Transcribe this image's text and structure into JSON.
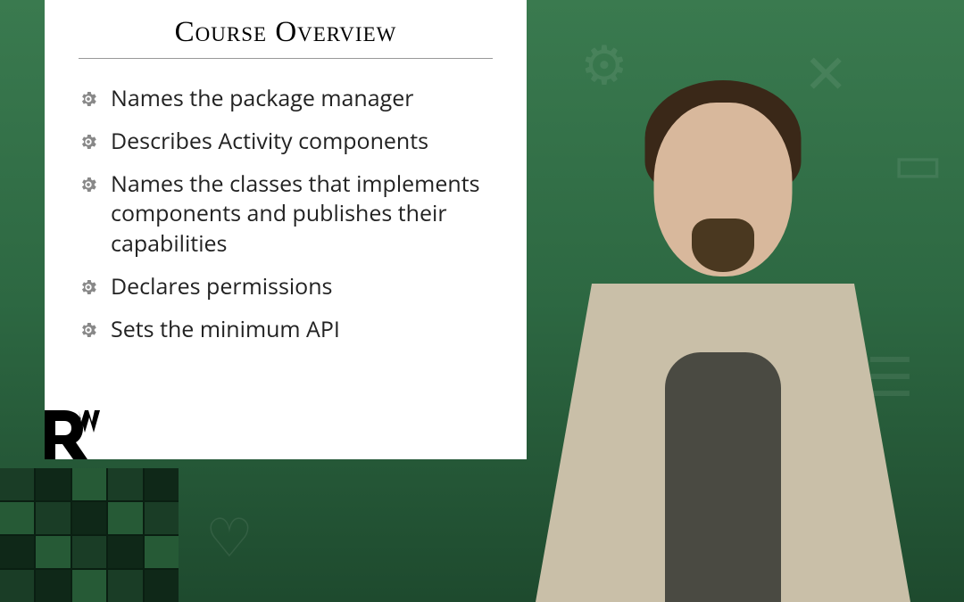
{
  "slide": {
    "title": "Course Overview",
    "bullets": [
      "Names the package manager",
      "Describes Activity components",
      "Names the classes that implements components and publishes their capabilities",
      "Declares permissions",
      "Sets the minimum API"
    ]
  }
}
